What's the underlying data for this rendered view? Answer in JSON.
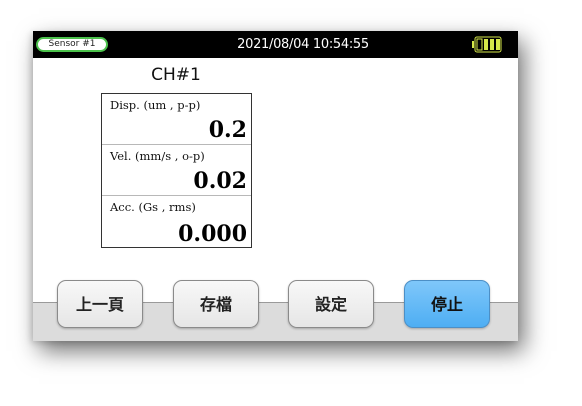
{
  "status_bar": {
    "sensor_label": "Sensor #1",
    "datetime": "2021/08/04 10:54:55",
    "battery_icon": "battery-icon",
    "battery_color": "#d6e84a"
  },
  "channel": {
    "title": "CH#1"
  },
  "measurements": [
    {
      "label": "Disp. (um , p-p)",
      "value": "0.2"
    },
    {
      "label": "Vel. (mm/s , o-p)",
      "value": "0.02"
    },
    {
      "label": "Acc. (Gs , rms)",
      "value": "0.000"
    }
  ],
  "buttons": {
    "prev_page": "上一頁",
    "save": "存檔",
    "settings": "設定",
    "stop": "停止"
  },
  "colors": {
    "status_bar_bg": "#000000",
    "sensor_pill_border": "#4cc24c",
    "stop_button": "#5db6f5"
  }
}
